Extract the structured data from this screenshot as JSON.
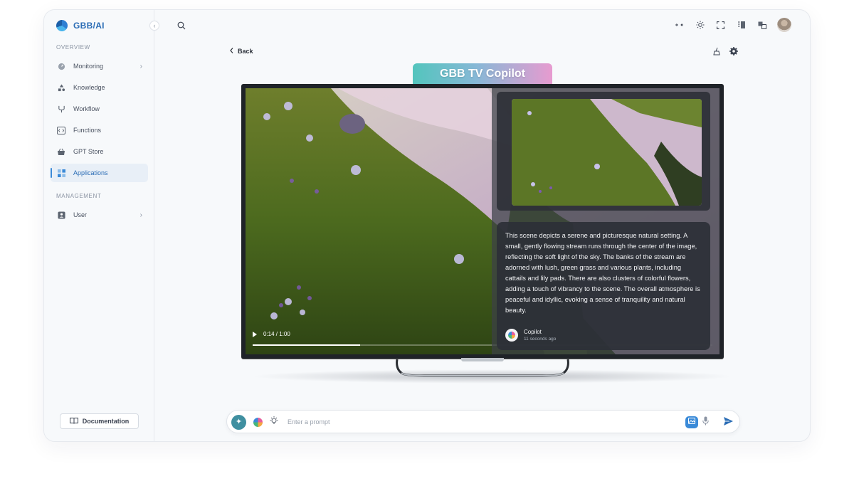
{
  "app": {
    "brand": "GBB/AI"
  },
  "sidebar": {
    "sections": [
      {
        "label": "OVERVIEW"
      },
      {
        "label": "MANAGEMENT"
      }
    ],
    "items": [
      {
        "label": "Monitoring",
        "icon": "gauge-icon",
        "has_chevron": true
      },
      {
        "label": "Knowledge",
        "icon": "shapes-icon",
        "has_chevron": false
      },
      {
        "label": "Workflow",
        "icon": "branch-icon",
        "has_chevron": false
      },
      {
        "label": "Functions",
        "icon": "code-icon",
        "has_chevron": false
      },
      {
        "label": "GPT Store",
        "icon": "basket-icon",
        "has_chevron": false
      },
      {
        "label": "Applications",
        "icon": "grid-icon",
        "has_chevron": false,
        "active": true
      },
      {
        "label": "User",
        "icon": "user-card-icon",
        "has_chevron": true
      }
    ],
    "documentation_label": "Documentation"
  },
  "header": {
    "icons": [
      "collapse-arrows-icon",
      "sun-icon",
      "fullscreen-icon",
      "panel-icon",
      "translate-icon",
      "avatar"
    ]
  },
  "page": {
    "back_label": "Back",
    "tool_icons": [
      "clean-icon",
      "settings-icon"
    ],
    "tv_title": "GBB TV Copilot",
    "video": {
      "time": "0:14 / 1:00",
      "progress": 0.233
    },
    "description": "This scene depicts a serene and picturesque natural setting. A small, gently flowing stream runs through the center of the image, reflecting the soft light of the sky. The banks of the stream are adorned with lush, green grass and various plants, including cattails and lily pads. There are also clusters of colorful flowers, adding a touch of vibrancy to the scene. The overall atmosphere is peaceful and idyllic, evoking a sense of tranquility and natural beauty.",
    "author": "Copilot",
    "timestamp": "11 seconds ago"
  },
  "prompt": {
    "placeholder": "Enter a prompt"
  },
  "colors": {
    "accent": "#3a8ad8",
    "brand": "#2a6cb5",
    "tv_label_gradient": [
      "#53c5bd",
      "#86b8d6",
      "#e79bd0"
    ]
  }
}
